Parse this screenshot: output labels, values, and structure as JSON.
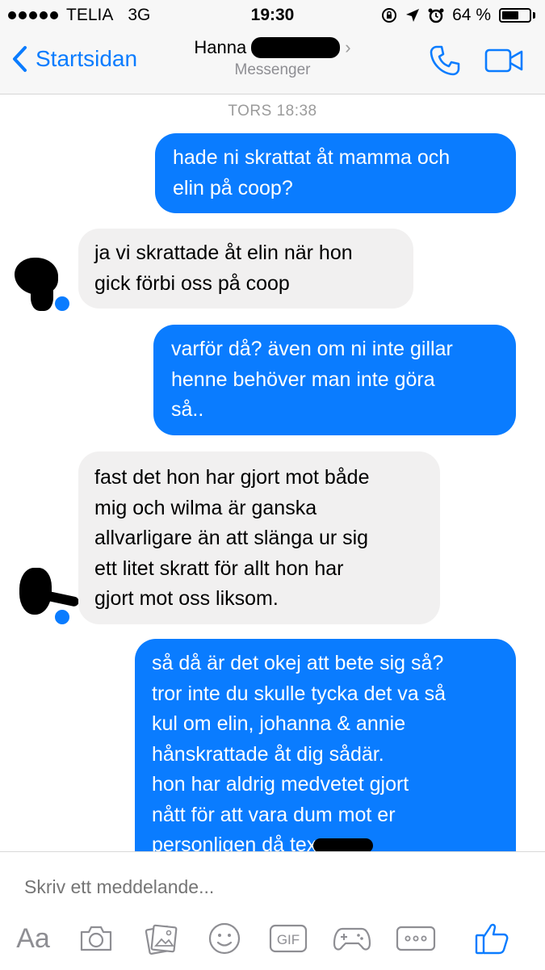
{
  "status_bar": {
    "carrier": "TELIA",
    "network": "3G",
    "time": "19:30",
    "battery_text": "64 %",
    "battery_level": 0.64
  },
  "nav": {
    "back_label": "Startsidan",
    "contact_name": "Hanna",
    "subtitle": "Messenger"
  },
  "chat": {
    "timestamp": "TORS 18:38",
    "messages": [
      {
        "direction": "outgoing",
        "text": "hade ni skrattat åt mamma och\nelin på coop?"
      },
      {
        "direction": "incoming",
        "text": "ja vi skrattade åt elin när hon\ngick förbi oss på coop"
      },
      {
        "direction": "outgoing",
        "text": "varför då? även om ni inte gillar\nhenne behöver man inte göra\nså.."
      },
      {
        "direction": "incoming",
        "text": "fast det hon har gjort mot både\nmig och wilma är ganska\nallvarligare än att slänga ur sig\nett litet skratt för allt hon har\ngjort mot oss liksom."
      },
      {
        "direction": "outgoing",
        "text": "så då är det okej att bete sig så?\ntror inte du skulle tycka det va så\nkul om elin, johanna & annie\nhånskrattade åt dig sådär.\nhon har aldrig medvetet gjort\nnått för att vara dum mot er\npersonligen då      tex"
      }
    ]
  },
  "composer": {
    "placeholder": "Skriv ett meddelande...",
    "aa_label": "Aa",
    "gif_label": "GIF",
    "icons": [
      "camera-icon",
      "gallery-icon",
      "emoji-icon",
      "gif-icon",
      "game-controller-icon",
      "more-icon",
      "thumbs-up-icon"
    ]
  },
  "colors": {
    "accent": "#0a7cff",
    "incoming_bubble": "#f1f0f0",
    "outgoing_bubble": "#0a7cff",
    "muted": "#8e8e93"
  }
}
